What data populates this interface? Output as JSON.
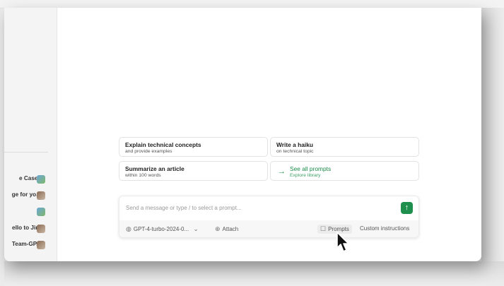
{
  "sidebar": {
    "items": [
      {
        "label": "e Cases",
        "avatar": "blue"
      },
      {
        "label": "ge for yo...",
        "avatar": "brown"
      },
      {
        "label": "",
        "avatar": "blue"
      },
      {
        "label": "ello to Jira",
        "avatar": "brown"
      },
      {
        "label": "Team-GP...",
        "avatar": "brown"
      }
    ]
  },
  "suggestions": [
    {
      "title": "Explain technical concepts",
      "subtitle": "and provide examples"
    },
    {
      "title": "Write a haiku",
      "subtitle": "on technical topic"
    },
    {
      "title": "Summarize an article",
      "subtitle": "within 100 words"
    }
  ],
  "library": {
    "title": "See all prompts",
    "subtitle": "Explore library",
    "icon": "arrow-right-icon"
  },
  "composer": {
    "placeholder": "Send a message or type / to select a prompt...",
    "send_icon": "arrow-up-icon",
    "model": "GPT-4-turbo-2024-0...",
    "attach": "Attach",
    "prompts": "Prompts",
    "custom": "Custom instructions"
  },
  "colors": {
    "accent": "#1f8f4e"
  }
}
